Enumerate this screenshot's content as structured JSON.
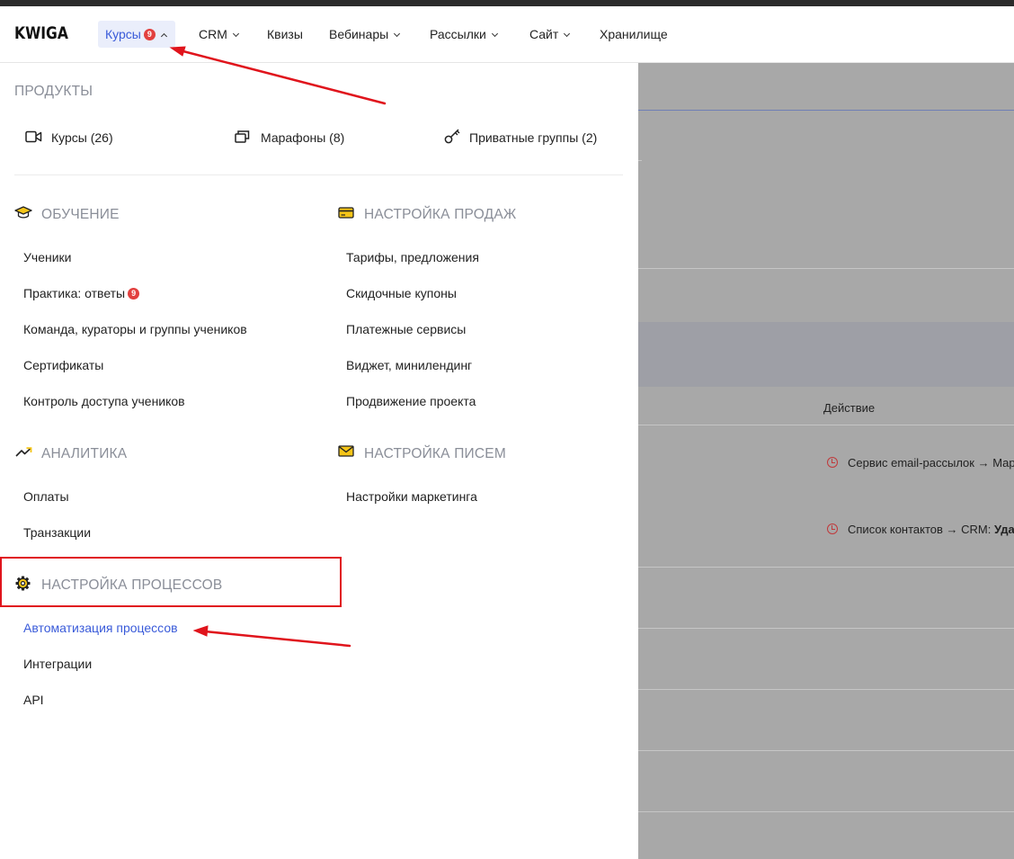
{
  "header": {
    "logo": "KWIGA",
    "nav": [
      {
        "label": "Курсы",
        "badge": "9",
        "active": true
      },
      {
        "label": "CRM"
      },
      {
        "label": "Квизы"
      },
      {
        "label": "Вебинары"
      },
      {
        "label": "Рассылки"
      },
      {
        "label": "Сайт"
      },
      {
        "label": "Хранилище"
      }
    ]
  },
  "dropdown": {
    "products_title": "ПРОДУКТЫ",
    "products": [
      {
        "label": "Курсы (26)",
        "icon": "video-camera-icon"
      },
      {
        "label": "Марафоны (8)",
        "icon": "stacked-cards-icon"
      },
      {
        "label": "Приватные группы (2)",
        "icon": "key-icon"
      }
    ],
    "learning": {
      "title": "ОБУЧЕНИЕ",
      "icon": "graduation-cap-icon",
      "items": [
        "Ученики",
        "Практика: ответы",
        "Команда, кураторы и группы учеников",
        "Сертификаты",
        "Контроль доступа учеников"
      ],
      "practice_badge": "9"
    },
    "sales": {
      "title": "НАСТРОЙКА ПРОДАЖ",
      "icon": "credit-card-icon",
      "items": [
        "Тарифы, предложения",
        "Скидочные купоны",
        "Платежные сервисы",
        "Виджет, минилендинг",
        "Продвижение проекта"
      ]
    },
    "analytics": {
      "title": "АНАЛИТИКА",
      "icon": "trend-up-icon",
      "items": [
        "Оплаты",
        "Транзакции"
      ]
    },
    "letters": {
      "title": "НАСТРОЙКА ПИСЕМ",
      "icon": "envelope-icon",
      "items": [
        "Настройки маркетинга"
      ]
    },
    "processes": {
      "title": "НАСТРОЙКА ПРОЦЕССОВ",
      "icon": "gear-icon",
      "items": [
        "Автоматизация процессов",
        "Интеграции",
        "API"
      ]
    }
  },
  "background": {
    "action_header": "Действие",
    "rows": [
      "Сервис email-рассылок → Мар",
      "Список контактов → CRM: "
    ],
    "row2_bold": "Уда"
  },
  "colors": {
    "accent": "#3a5bd9",
    "badge": "#e2403f",
    "icon_yellow": "#f5c518",
    "annotation_red": "#e0141c"
  }
}
